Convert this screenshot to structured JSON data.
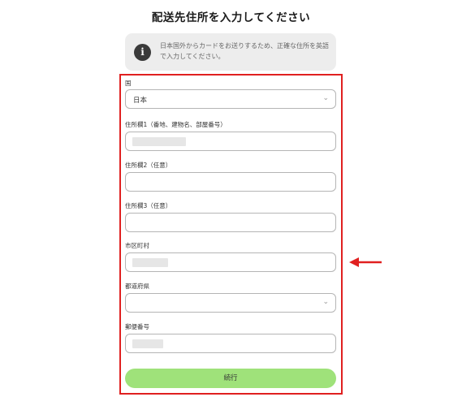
{
  "page": {
    "title": "配送先住所を入力してください"
  },
  "notice": {
    "icon": "info-icon",
    "text": "日本国外からカードをお送りするため、正確な住所を英語で入力してください。"
  },
  "form": {
    "country": {
      "label": "国",
      "value": "日本"
    },
    "address1": {
      "label": "住所欄1（番地、建物名、部屋番号）",
      "value_masked": true
    },
    "address2": {
      "label": "住所欄2（任意）",
      "value": ""
    },
    "address3": {
      "label": "住所欄3（任意）",
      "value": ""
    },
    "city": {
      "label": "市区町村",
      "value_masked": true
    },
    "prefecture": {
      "label": "都道府県",
      "value": ""
    },
    "postal": {
      "label": "郵便番号",
      "value_masked": true
    },
    "submit_label": "続行"
  },
  "annotations": {
    "highlight_color": "#e02020",
    "arrow_color": "#e02020"
  },
  "colors": {
    "accent_button": "#9fe27a",
    "notice_background": "#ededed"
  }
}
